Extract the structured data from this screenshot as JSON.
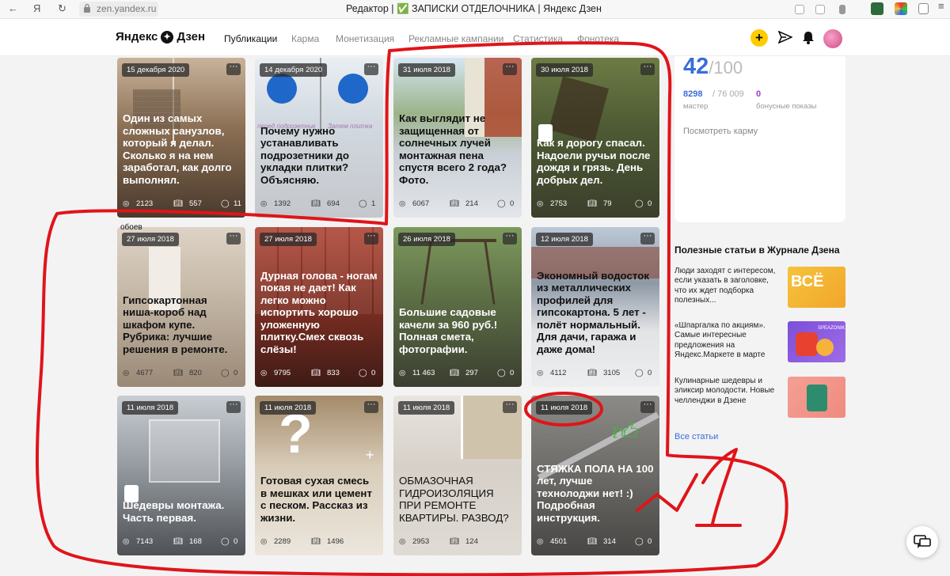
{
  "browser": {
    "url": "zen.yandex.ru",
    "tab_title": "Редактор | ✅ ЗАПИСКИ ОТДЕЛОЧНИКА | Яндекс Дзен",
    "yandex_letter": "Я"
  },
  "header": {
    "logo_text": "Яндекс",
    "logo_text2": "Дзен",
    "nav": [
      "Публикации",
      "Карма",
      "Монетизация",
      "Рекламные кампании",
      "Статистика",
      "Фонотека"
    ],
    "plus": "+"
  },
  "cards": [
    {
      "date": "15 декабря 2020",
      "title": "Один из самых сложных санузлов, который я делал. Сколько я на нем заработал, как долго выполнял.",
      "views": "2123",
      "reads": "557",
      "comments": "11"
    },
    {
      "date": "14 декабря 2020",
      "title": "Почему нужно устанавливать подрозетники до укладки плитки? Объясняю.",
      "views": "1392",
      "reads": "694",
      "comments": "1"
    },
    {
      "date": "31 июля 2018",
      "title": "Как выглядит не защищенная от солнечных лучей монтажная пена спустя всего 2 года? Фото.",
      "views": "6067",
      "reads": "214",
      "comments": "0"
    },
    {
      "date": "30 июля 2018",
      "title": "Как я дорогу спасал. Надоели ручьи после дождя и грязь. День добрых дел.",
      "views": "2753",
      "reads": "79",
      "comments": "0"
    },
    {
      "date": "27 июля 2018",
      "title": "Гипсокартонная ниша-короб над шкафом купе. Рубрика: лучшие решения в ремонте.",
      "views": "4677",
      "reads": "820",
      "comments": "0"
    },
    {
      "date": "27 июля 2018",
      "title": "Дурная голова - ногам покая не дает! Как легко можно испортить хорошо уложенную плитку.Смех сквозь слёзы!",
      "views": "9795",
      "reads": "833",
      "comments": "0"
    },
    {
      "date": "26 июля 2018",
      "title": "Большие садовые качели за 960 руб.! Полная смета, фотографии.",
      "views": "11 463",
      "reads": "297",
      "comments": "0"
    },
    {
      "date": "12 июля 2018",
      "title": "Экономный водосток из металлических профилей для гипсокартона. 5 лет - полёт нормальный. Для дачи, гаража и даже дома!",
      "views": "4112",
      "reads": "3105",
      "comments": "0"
    },
    {
      "date": "11 июля 2018",
      "title": "Шедевры монтажа. Часть первая.",
      "views": "7143",
      "reads": "168",
      "comments": "0"
    },
    {
      "date": "11 июля 2018",
      "title": "Готовая сухая смесь в мешках или цемент с песком. Рассказ из жизни.",
      "views": "2289",
      "reads": "1496",
      "comments": ""
    },
    {
      "date": "11 июля 2018",
      "title": "ОБМАЗОЧНАЯ ГИДРОИЗОЛЯЦИЯ ПРИ РЕМОНТЕ КВАРТИРЫ. РАЗВОД?",
      "views": "2953",
      "reads": "124",
      "comments": ""
    },
    {
      "date": "11 июля 2018",
      "title": "СТЯЖКА ПОЛА НА 100 лет, лучше технолоджи нет! :) Подробная инструкция.",
      "views": "4501",
      "reads": "314",
      "comments": "0"
    }
  ],
  "card_overlay_texts": {
    "podrozetnik_a": "перед подрозетник",
    "podrozetnik_b": "Затем плитка",
    "oboev": "обоев"
  },
  "karma": {
    "score": "42",
    "max": "/100",
    "master_value": "8298",
    "master_total": "/ 76 009",
    "master_label": "мастер",
    "bonus_value": "0",
    "bonus_label": "бонусные показы",
    "link": "Посмотреть карму"
  },
  "sidebar": {
    "heading": "Полезные статьи в Журнале Дзена",
    "articles": [
      {
        "text": "Люди заходят с интересом, если указать в заголовке, что их ждет подборка полезных...",
        "img_text": "ВСЁ"
      },
      {
        "text": "«Шпаргалка по акциям». Самые интересные предложения на Яндекс.Маркете в марте",
        "img_text": "SPEAZONIK"
      },
      {
        "text": "Кулинарные шедевры и эликсир молодости. Новые челленджи в Дзене",
        "img_text": ""
      }
    ],
    "all_link": "Все статьи"
  },
  "annotation": {
    "text": "№1",
    "color": "#e0141a"
  }
}
